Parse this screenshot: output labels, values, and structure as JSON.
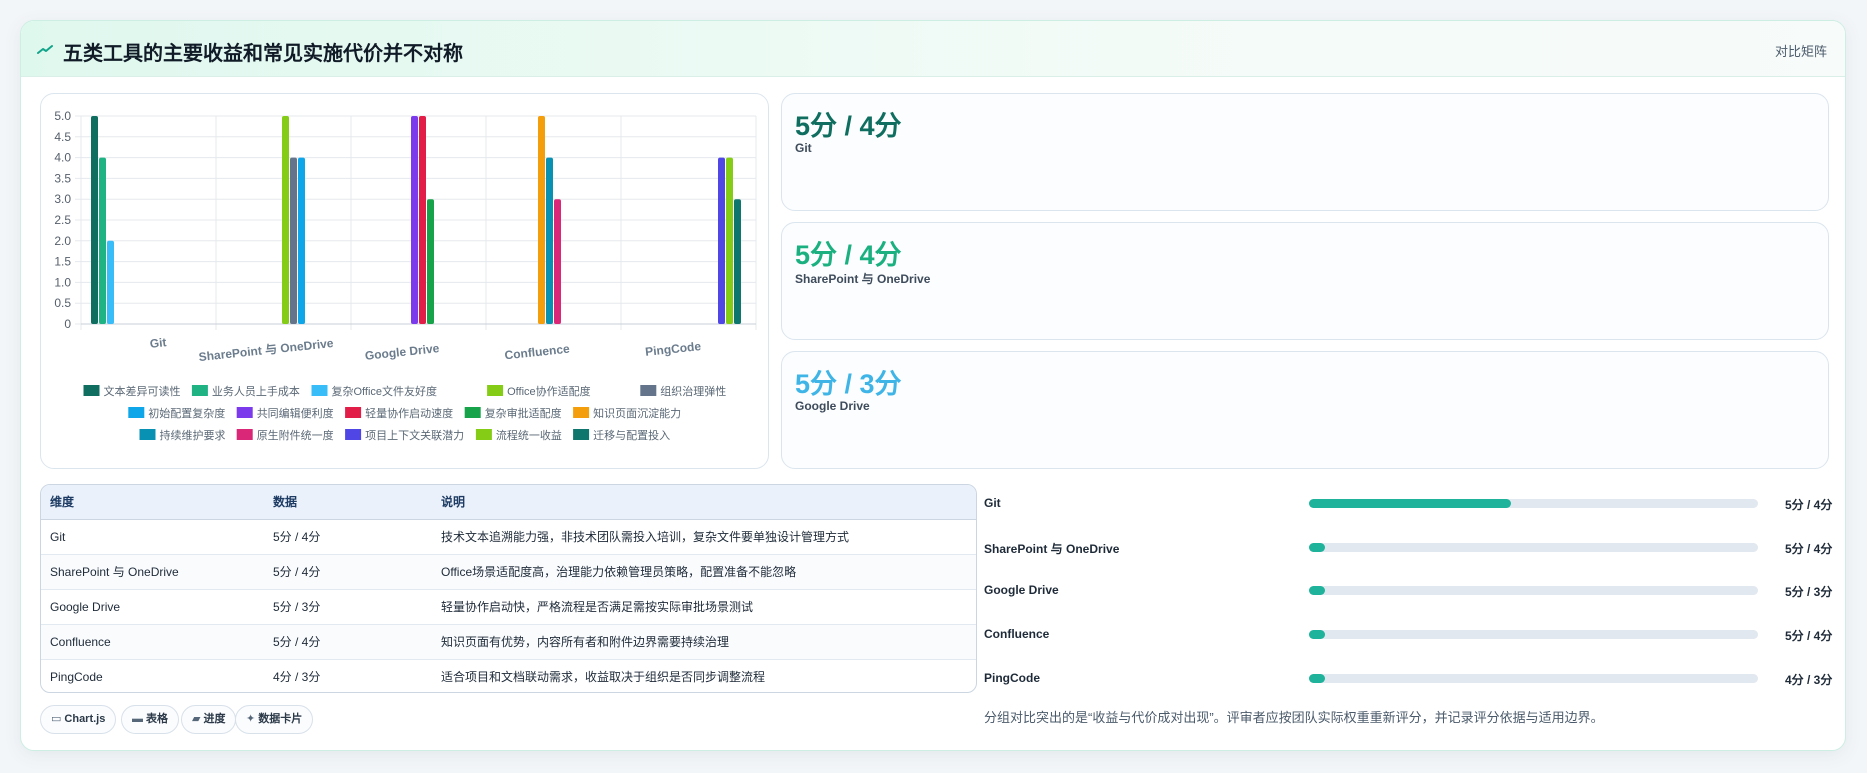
{
  "header": {
    "title": "五类工具的主要收益和常见实施代价并不对称",
    "right_link": "对比矩阵",
    "icon": "trend-line-icon"
  },
  "kpis": [
    {
      "value": "5分 / 4分",
      "label": "Git",
      "color": "#0f6e5f"
    },
    {
      "value": "5分 / 4分",
      "label": "SharePoint 与 OneDrive",
      "color": "#1bb07f"
    },
    {
      "value": "5分 / 3分",
      "label": "Google Drive",
      "color": "#3fb4e6"
    }
  ],
  "chart_data": {
    "type": "bar",
    "categories": [
      "Git",
      "SharePoint 与 OneDrive",
      "Google Drive",
      "Confluence",
      "PingCode"
    ],
    "ylim": [
      0,
      5
    ],
    "yticks": [
      "0",
      "0.5",
      "1.0",
      "1.5",
      "2.0",
      "2.5",
      "3.0",
      "3.5",
      "4.0",
      "4.5",
      "5.0"
    ],
    "grid": true,
    "legend_position": "bottom",
    "series": [
      {
        "name": "文本差异可读性",
        "color": "#0f6e5f",
        "values": [
          5,
          null,
          null,
          null,
          null
        ]
      },
      {
        "name": "业务人员上手成本",
        "color": "#1fb384",
        "values": [
          4,
          null,
          null,
          null,
          null
        ]
      },
      {
        "name": "复杂Office文件友好度",
        "color": "#38bdf8",
        "values": [
          2,
          null,
          null,
          null,
          null
        ]
      },
      {
        "name": "Office协作适配度",
        "color": "#84cc16",
        "values": [
          null,
          5,
          null,
          null,
          null
        ]
      },
      {
        "name": "组织治理弹性",
        "color": "#64748b",
        "values": [
          null,
          4,
          null,
          null,
          null
        ]
      },
      {
        "name": "初始配置复杂度",
        "color": "#0ea5e9",
        "values": [
          null,
          4,
          null,
          null,
          null
        ]
      },
      {
        "name": "共同编辑便利度",
        "color": "#7c3aed",
        "values": [
          null,
          null,
          5,
          null,
          null
        ]
      },
      {
        "name": "轻量协作启动速度",
        "color": "#e11d48",
        "values": [
          null,
          null,
          5,
          null,
          null
        ]
      },
      {
        "name": "复杂审批适配度",
        "color": "#16a34a",
        "values": [
          null,
          null,
          3,
          null,
          null
        ]
      },
      {
        "name": "知识页面沉淀能力",
        "color": "#f59e0b",
        "values": [
          null,
          null,
          null,
          5,
          null
        ]
      },
      {
        "name": "持续维护要求",
        "color": "#0891b2",
        "values": [
          null,
          null,
          null,
          4,
          null
        ]
      },
      {
        "name": "原生附件统一度",
        "color": "#db2777",
        "values": [
          null,
          null,
          null,
          3,
          null
        ]
      },
      {
        "name": "项目上下文关联潜力",
        "color": "#4f46e5",
        "values": [
          null,
          null,
          null,
          null,
          4
        ]
      },
      {
        "name": "流程统一收益",
        "color": "#84cc16",
        "values": [
          null,
          null,
          null,
          null,
          4
        ]
      },
      {
        "name": "迁移与配置投入",
        "color": "#0f766e",
        "values": [
          null,
          null,
          null,
          null,
          3
        ]
      }
    ]
  },
  "table": {
    "headers": [
      "维度",
      "数据",
      "说明"
    ],
    "rows": [
      [
        "Git",
        "5分 / 4分",
        "技术文本追溯能力强，非技术团队需投入培训，复杂文件要单独设计管理方式"
      ],
      [
        "SharePoint 与 OneDrive",
        "5分 / 4分",
        "Office场景适配度高，治理能力依赖管理员策略，配置准备不能忽略"
      ],
      [
        "Google Drive",
        "5分 / 3分",
        "轻量协作启动快，严格流程是否满足需按实际审批场景测试"
      ],
      [
        "Confluence",
        "5分 / 4分",
        "知识页面有优势，内容所有者和附件边界需要持续治理"
      ],
      [
        "PingCode",
        "4分 / 3分",
        "适合项目和文档联动需求，收益取决于组织是否同步调整流程"
      ]
    ]
  },
  "chips": [
    {
      "icon": "▭",
      "label": "Chart.js",
      "icon_name": "chart-icon"
    },
    {
      "icon": "▬",
      "label": "表格",
      "icon_name": "table-icon"
    },
    {
      "icon": "▰",
      "label": "进度",
      "icon_name": "progress-icon"
    },
    {
      "icon": "✦",
      "label": "数据卡片",
      "icon_name": "card-icon"
    }
  ],
  "progress": [
    {
      "label": "Git",
      "value": "5分 / 4分",
      "fraction": 0.45
    },
    {
      "label": "SharePoint 与 OneDrive",
      "value": "5分 / 4分",
      "fraction": 0.035
    },
    {
      "label": "Google Drive",
      "value": "5分 / 3分",
      "fraction": 0.035
    },
    {
      "label": "Confluence",
      "value": "5分 / 4分",
      "fraction": 0.035
    },
    {
      "label": "PingCode",
      "value": "4分 / 3分",
      "fraction": 0.035
    }
  ],
  "note": "分组对比突出的是“收益与代价成对出现”。评审者应按团队实际权重重新评分，并记录评分依据与适用边界。"
}
